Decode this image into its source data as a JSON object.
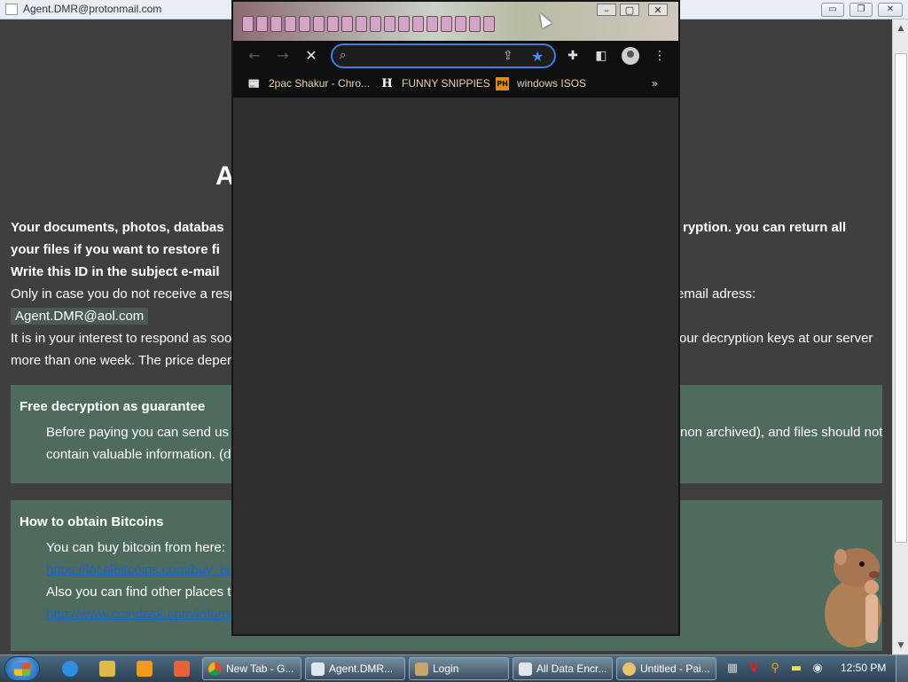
{
  "bg_window": {
    "title": "Agent.DMR@protonmail.com",
    "minimize": "▭",
    "restore": "❐",
    "close": "✕"
  },
  "ransom": {
    "heading": "A",
    "line1": "Your documents, photos, databas",
    "line1_right": "ryption. you can return all",
    "line2": "your files if you want to restore fi",
    "line3": "Write this ID in the subject e-mail",
    "line4": "Only in case you do not receive a resp",
    "line4_right": "email adress:",
    "email": "Agent.DMR@aol.com",
    "line5": "It is in your interest to respond as soo",
    "line5_right": "our decryption keys at our server",
    "line6": "more than one week. The price deper",
    "panel1": {
      "heading": "Free decryption as guarantee",
      "text1": "Before paying you can send us",
      "text1_right": "non archived), and files should not",
      "text2": "contain valuable information. (da"
    },
    "panel2": {
      "heading": "How to obtain Bitcoins",
      "text1": "You can buy bitcoin from here:",
      "link1": "https://localbitcoins.com/buy_bitco",
      "text2": "Also you can find other places to",
      "link2": "http://www.coindesk.com/informa"
    }
  },
  "chrome": {
    "omnibox_value": "",
    "omnibox_placeholder": "",
    "bookmarks": [
      {
        "label": "2pac Shakur - Chro...",
        "icon": "📰"
      },
      {
        "label": "FUNNY SNIPPIES",
        "icon": "H"
      },
      {
        "label": "windows ISOS",
        "icon": "PH"
      }
    ],
    "more_bookmarks": "»"
  },
  "taskbar": {
    "tasks": [
      {
        "label": "New Tab - G..."
      },
      {
        "label": "Agent.DMR..."
      },
      {
        "label": "Login"
      },
      {
        "label": "All Data Encr..."
      },
      {
        "label": "Untitled - Pai..."
      }
    ],
    "clock": "12:50 PM"
  }
}
